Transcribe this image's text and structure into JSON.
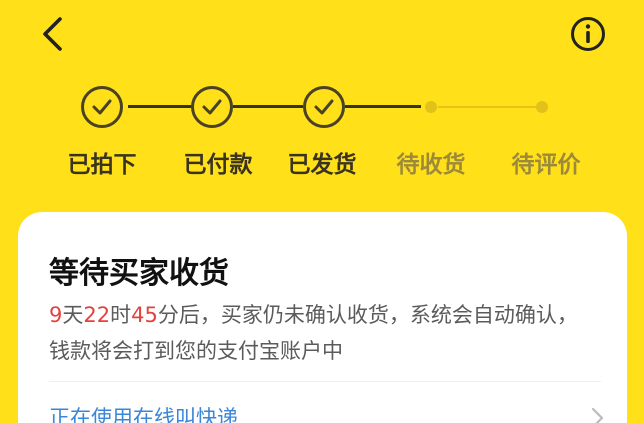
{
  "header": {
    "back_icon": "chevron-left-icon",
    "info_icon": "info-circle-icon"
  },
  "progress": {
    "steps": [
      {
        "label": "已拍下",
        "status": "done"
      },
      {
        "label": "已付款",
        "status": "done"
      },
      {
        "label": "已发货",
        "status": "done"
      },
      {
        "label": "待收货",
        "status": "pending"
      },
      {
        "label": "待评价",
        "status": "pending"
      }
    ],
    "colors": {
      "done": "#3a3320",
      "pending": "#9c8a3a",
      "background": "#FFE019"
    }
  },
  "card": {
    "title": "等待买家收货",
    "countdown": {
      "days": "9",
      "days_unit": "天",
      "hours": "22",
      "hours_unit": "时",
      "minutes": "45",
      "minutes_unit": "分后，"
    },
    "description": "买家仍未确认收货，系统会自动确认，钱款将会打到您的支付宝账户中",
    "express_link": "正在使用在线叫快递",
    "colors": {
      "countdown": "#E2433F",
      "link": "#3B86D9"
    }
  }
}
